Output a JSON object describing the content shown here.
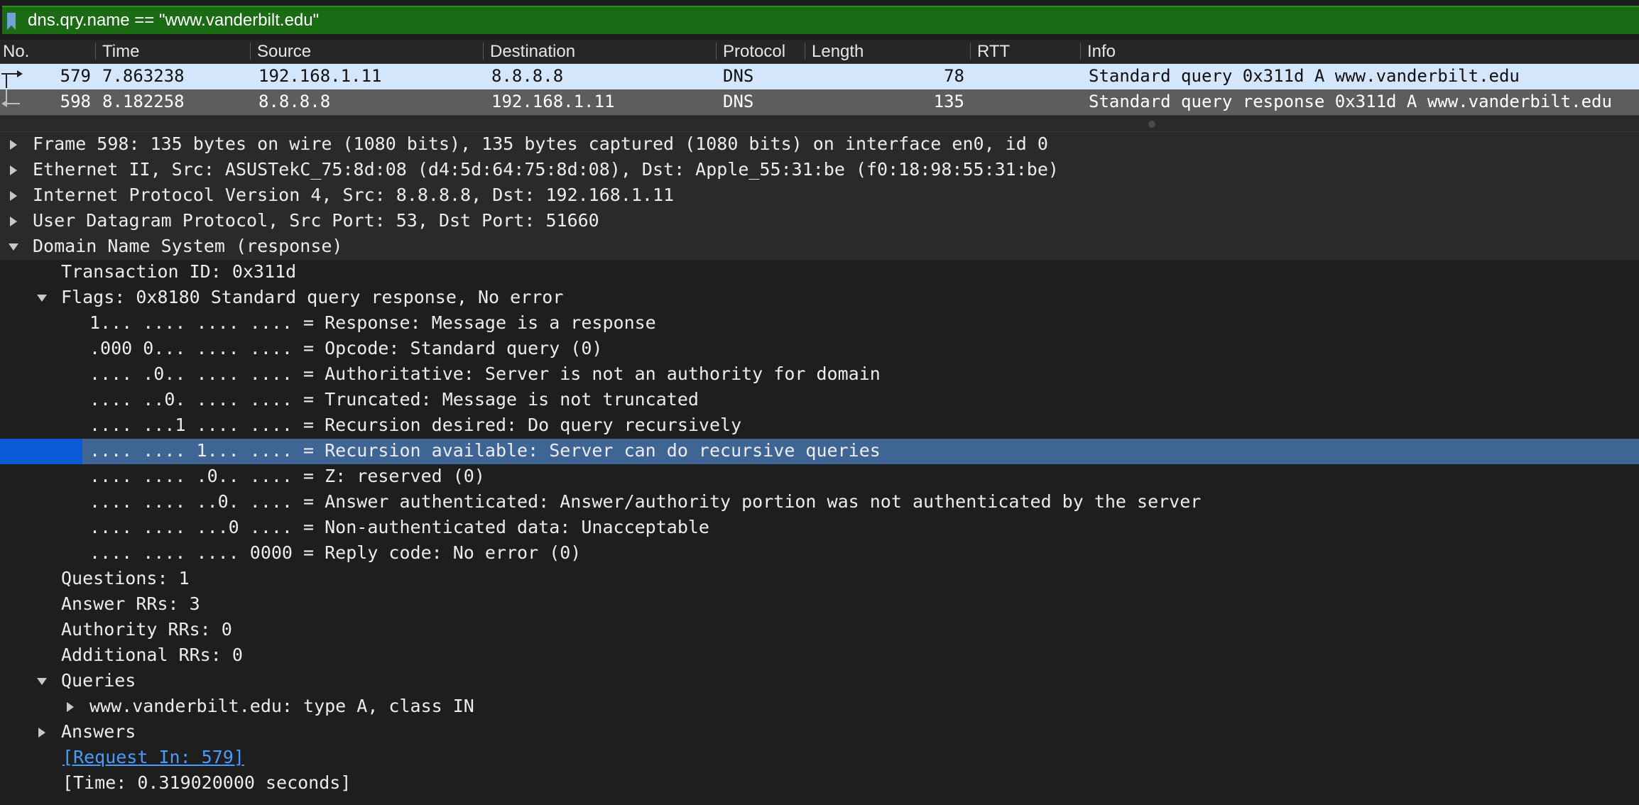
{
  "filter": {
    "expression": "dns.qry.name == \"www.vanderbilt.edu\"",
    "accent_color": "#1a6b13"
  },
  "packet_list": {
    "columns": [
      "No.",
      "Time",
      "Source",
      "Destination",
      "Protocol",
      "Length",
      "RTT",
      "Info"
    ],
    "rows": [
      {
        "no": "579",
        "time": "7.863238",
        "source": "192.168.1.11",
        "destination": "8.8.8.8",
        "protocol": "DNS",
        "length": "78",
        "rtt": "",
        "info": "Standard query 0x311d A www.vanderbilt.edu",
        "selected": true,
        "relation_icon": "request-arrow-icon"
      },
      {
        "no": "598",
        "time": "8.182258",
        "source": "8.8.8.8",
        "destination": "192.168.1.11",
        "protocol": "DNS",
        "length": "135",
        "rtt": "",
        "info": "Standard query response 0x311d A www.vanderbilt.edu",
        "selected": false,
        "relation_icon": "response-arrow-icon"
      }
    ]
  },
  "details": {
    "frame": "Frame 598: 135 bytes on wire (1080 bits), 135 bytes captured (1080 bits) on interface en0, id 0",
    "ethernet": "Ethernet II, Src: ASUSTekC_75:8d:08 (d4:5d:64:75:8d:08), Dst: Apple_55:31:be (f0:18:98:55:31:be)",
    "ip": "Internet Protocol Version 4, Src: 8.8.8.8, Dst: 192.168.1.11",
    "udp": "User Datagram Protocol, Src Port: 53, Dst Port: 51660",
    "dns": "Domain Name System (response)",
    "transaction_id": "Transaction ID: 0x311d",
    "flags": "Flags: 0x8180 Standard query response, No error",
    "flag_bits": [
      "1... .... .... .... = Response: Message is a response",
      ".000 0... .... .... = Opcode: Standard query (0)",
      ".... .0.. .... .... = Authoritative: Server is not an authority for domain",
      ".... ..0. .... .... = Truncated: Message is not truncated",
      ".... ...1 .... .... = Recursion desired: Do query recursively",
      ".... .... 1... .... = Recursion available: Server can do recursive queries",
      ".... .... .0.. .... = Z: reserved (0)",
      ".... .... ..0. .... = Answer authenticated: Answer/authority portion was not authenticated by the server",
      ".... .... ...0 .... = Non-authenticated data: Unacceptable",
      ".... .... .... 0000 = Reply code: No error (0)"
    ],
    "questions": "Questions: 1",
    "answer_rrs": "Answer RRs: 3",
    "authority_rrs": "Authority RRs: 0",
    "additional_rrs": "Additional RRs: 0",
    "queries": "Queries",
    "query_entry": "www.vanderbilt.edu: type A, class IN",
    "answers": "Answers",
    "request_in": "[Request In: 579]",
    "time": "[Time: 0.319020000 seconds]"
  },
  "colors": {
    "selected_packet_row": "#d3e6fb",
    "other_packet_row": "#5d5d5d",
    "highlight_field_row": "#3f6594",
    "highlight_gutter": "#0a5ad8",
    "link": "#4a9bff"
  }
}
